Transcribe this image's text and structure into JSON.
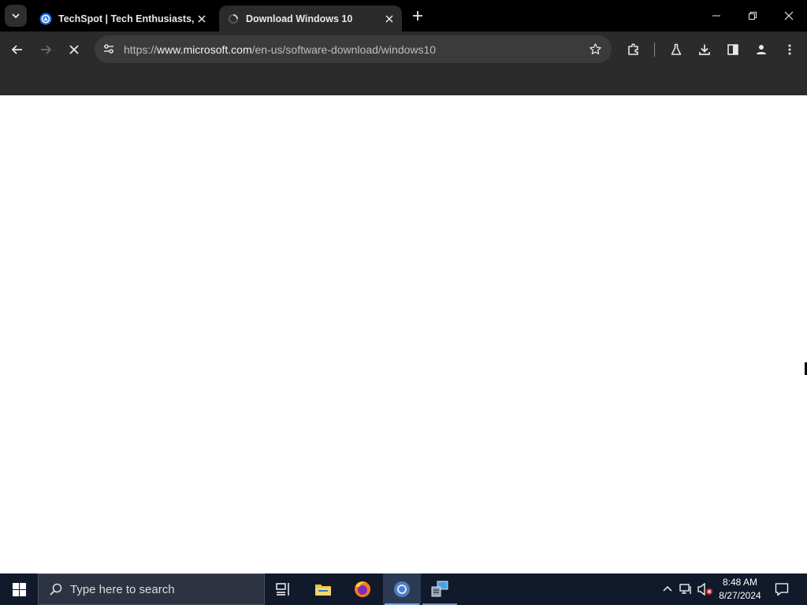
{
  "browser": {
    "tabs": [
      {
        "title": "TechSpot | Tech Enthusiasts, Po",
        "active": false,
        "favicon": "techspot-logo-icon"
      },
      {
        "title": "Download Windows 10",
        "active": true,
        "favicon": "loading-spinner-icon"
      }
    ],
    "address": {
      "scheme": "https://",
      "host": "www.microsoft.com",
      "path": "/en-us/software-download/windows10"
    }
  },
  "taskbar": {
    "search_placeholder": "Type here to search",
    "apps": [
      "task-view-icon",
      "file-explorer-icon",
      "firefox-icon",
      "chrome-icon",
      "network-tool-icon"
    ],
    "clock": {
      "time": "8:48 AM",
      "date": "8/27/2024"
    }
  },
  "colors": {
    "tabstrip": "#000000",
    "toolbar": "#2b2b2b",
    "omnibox": "#3b3b3b",
    "taskbar": "#101a2b"
  }
}
